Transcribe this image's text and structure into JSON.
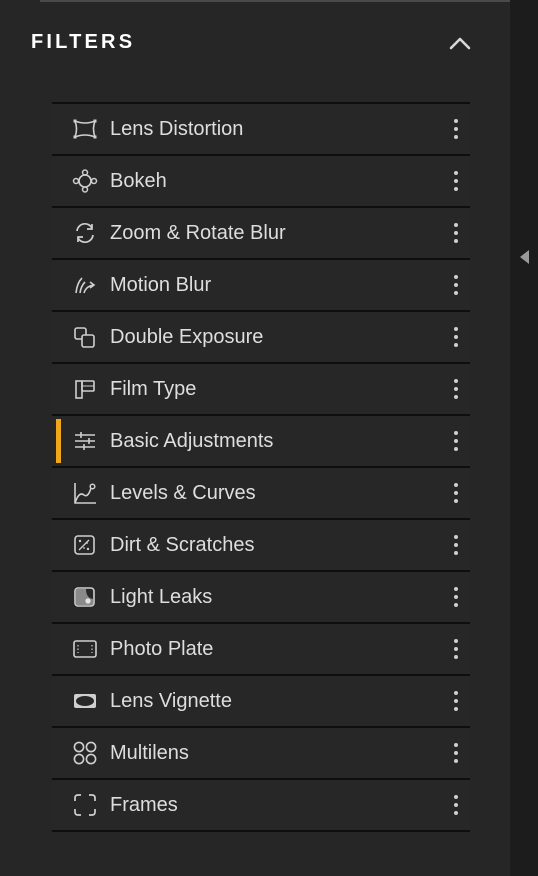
{
  "panel": {
    "title": "FILTERS",
    "toggle_icon": "chevron-up-icon",
    "accent_color": "#f0a81a"
  },
  "filters": [
    {
      "label": "Lens Distortion",
      "icon": "lens-distortion-icon"
    },
    {
      "label": "Bokeh",
      "icon": "bokeh-icon"
    },
    {
      "label": "Zoom & Rotate Blur",
      "icon": "zoom-rotate-icon"
    },
    {
      "label": "Motion Blur",
      "icon": "motion-blur-icon"
    },
    {
      "label": "Double Exposure",
      "icon": "double-exposure-icon"
    },
    {
      "label": "Film Type",
      "icon": "film-type-icon"
    },
    {
      "label": "Basic Adjustments",
      "icon": "sliders-icon",
      "active": true
    },
    {
      "label": "Levels & Curves",
      "icon": "curves-icon"
    },
    {
      "label": "Dirt & Scratches",
      "icon": "dirt-scratches-icon"
    },
    {
      "label": "Light Leaks",
      "icon": "light-leaks-icon"
    },
    {
      "label": "Photo Plate",
      "icon": "photo-plate-icon"
    },
    {
      "label": "Lens Vignette",
      "icon": "vignette-icon"
    },
    {
      "label": "Multilens",
      "icon": "multilens-icon"
    },
    {
      "label": "Frames",
      "icon": "frames-icon"
    }
  ]
}
